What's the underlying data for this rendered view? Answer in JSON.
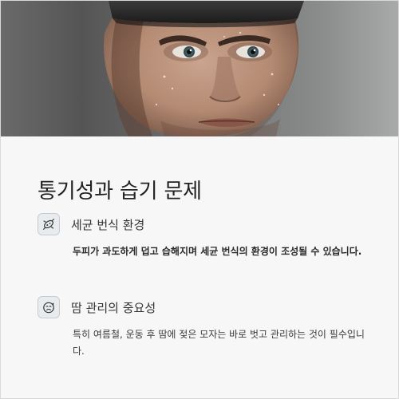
{
  "hero": {
    "image_icon": "portrait-photo"
  },
  "main": {
    "title": "통기성과 습기 문제",
    "sections": [
      {
        "icon": "bacteria-icon",
        "heading": "세균 번식 환경",
        "body": "두피가 과도하게 덥고 습해지며 세균 번식의 환경이 조성될 수 있습니다."
      },
      {
        "icon": "sweat-face-icon",
        "heading": "땀 관리의 중요성",
        "body": "특히 여름철, 운동 후 땀에 젖은 모자는 바로 벗고 관리하는 것이 필수입니다."
      }
    ]
  },
  "colors": {
    "background": "#f7f7f7",
    "icon_box": "#e9ecef",
    "text": "#222222"
  }
}
